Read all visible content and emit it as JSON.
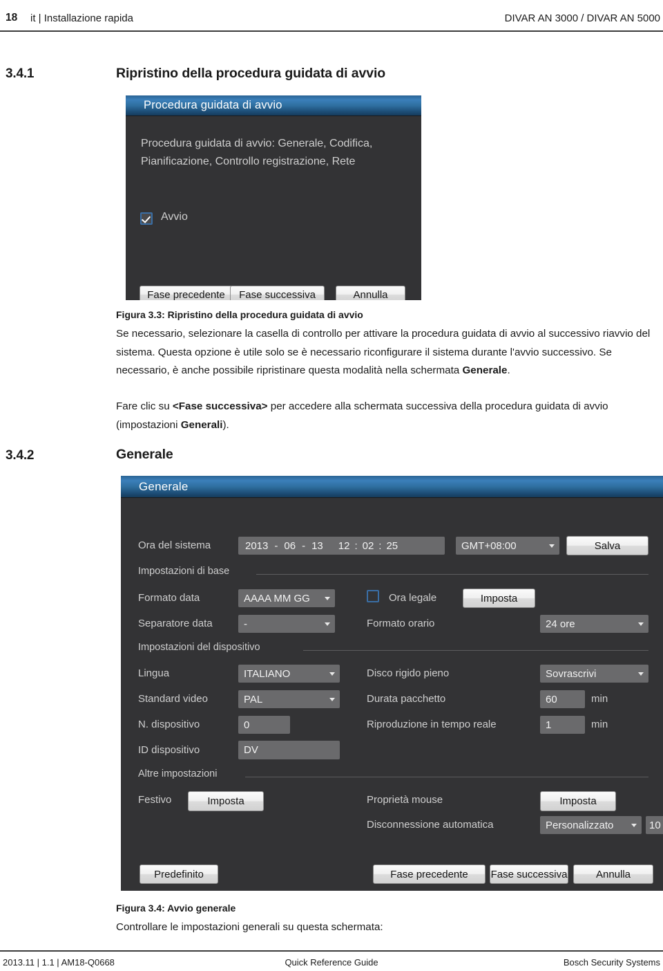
{
  "page_header": {
    "page_number": "18",
    "left_text": "it | Installazione rapida",
    "right_text": "DIVAR AN 3000 / DIVAR AN 5000"
  },
  "section_341": {
    "number": "3.4.1",
    "title": "Ripristino della procedura guidata di avvio"
  },
  "wizard_dialog": {
    "title": "Procedura guidata di avvio",
    "description_line1": "Procedura guidata di avvio: Generale, Codifica,",
    "description_line2": "Pianificazione, Controllo registrazione, Rete",
    "checkbox_label": "Avvio",
    "checkbox_checked": true,
    "btn_prev": "Fase precedente",
    "btn_next": "Fase successiva",
    "btn_cancel": "Annulla"
  },
  "figure_33": {
    "caption": "Figura 3.3: Ripristino della procedura guidata di avvio",
    "paragraph1_a": "Se necessario, selezionare la casella di controllo per attivare la procedura guidata di avvio al successivo riavvio del sistema. Questa opzione è utile solo se è necessario riconfigurare il sistema durante l'avvio successivo. Se necessario, è anche possibile ripristinare questa modalità nella schermata ",
    "paragraph1_b": "Generale",
    "paragraph1_c": ".",
    "paragraph2_a": "Fare clic su ",
    "paragraph2_b": "<Fase successiva>",
    "paragraph2_c": " per accedere alla schermata successiva della procedura guidata di avvio (impostazioni ",
    "paragraph2_d": "Generali",
    "paragraph2_e": ")."
  },
  "section_342": {
    "number": "3.4.2",
    "title": "Generale"
  },
  "general_dialog": {
    "title": "Generale",
    "system_time": {
      "label": "Ora del sistema",
      "year": "2013",
      "sep1": "-",
      "month": "06",
      "sep2": "-",
      "day": "13",
      "hour": "12",
      "sep3": ":",
      "minute": "02",
      "sep4": ":",
      "second": "25",
      "timezone": "GMT+08:00",
      "save_button": "Salva"
    },
    "group_base": "Impostazioni di base",
    "date_format": {
      "label": "Formato data",
      "value": "AAAA MM GG"
    },
    "dst": {
      "label": "Ora legale",
      "checked": false,
      "button": "Imposta"
    },
    "date_separator": {
      "label": "Separatore data",
      "value": "-"
    },
    "time_format": {
      "label": "Formato orario",
      "value": "24 ore"
    },
    "group_device": "Impostazioni del dispositivo",
    "language": {
      "label": "Lingua",
      "value": "ITALIANO"
    },
    "hdd_full": {
      "label": "Disco rigido pieno",
      "value": "Sovrascrivi"
    },
    "video_standard": {
      "label": "Standard video",
      "value": "PAL"
    },
    "pack_duration": {
      "label": "Durata pacchetto",
      "value": "60",
      "unit": "min"
    },
    "device_no": {
      "label": "N. dispositivo",
      "value": "0"
    },
    "realtime_play": {
      "label": "Riproduzione in tempo reale",
      "value": "1",
      "unit": "min"
    },
    "device_id": {
      "label": "ID dispositivo",
      "value": "DV"
    },
    "group_other": "Altre impostazioni",
    "holiday": {
      "label": "Festivo",
      "button": "Imposta"
    },
    "mouse_props": {
      "label": "Proprietà mouse",
      "button": "Imposta"
    },
    "auto_logout": {
      "label": "Disconnessione automatica",
      "value": "Personalizzato",
      "minutes": "10"
    },
    "btn_default": "Predefinito",
    "btn_prev": "Fase precedente",
    "btn_next": "Fase successiva",
    "btn_cancel": "Annulla"
  },
  "figure_34": {
    "caption": "Figura 3.4: Avvio generale",
    "text": "Controllare le impostazioni generali su questa schermata:"
  },
  "footer": {
    "left": "2013.11 | 1.1 | AM18-Q0668",
    "center": "Quick Reference Guide",
    "right": "Bosch Security Systems"
  }
}
